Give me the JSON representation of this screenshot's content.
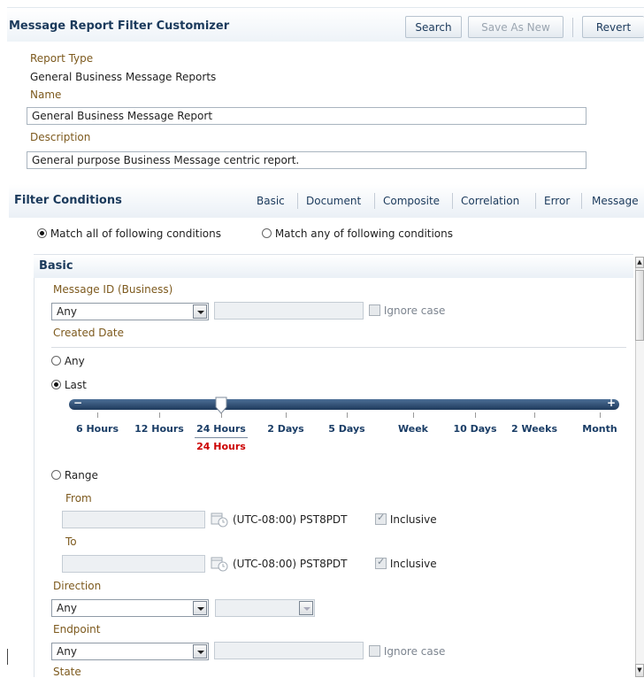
{
  "header": {
    "title": "Message Report Filter Customizer",
    "search_label": "Search",
    "save_as_new_label": "Save As New",
    "revert_label": "Revert"
  },
  "report": {
    "type_label": "Report Type",
    "type_value": "General Business Message Reports",
    "name_label": "Name",
    "name_value": "General Business Message Report",
    "description_label": "Description",
    "description_value": "General purpose Business Message centric report."
  },
  "filter": {
    "title": "Filter Conditions",
    "tabs": [
      "Basic",
      "Document",
      "Composite",
      "Correlation",
      "Error",
      "Message"
    ],
    "match_all_label": "Match all of following conditions",
    "match_any_label": "Match any of following conditions",
    "match_selected": "all"
  },
  "basic": {
    "title": "Basic",
    "message_id_label": "Message ID (Business)",
    "message_id_select": "Any",
    "message_id_value": "",
    "ignore_case_label": "Ignore case",
    "created_date_label": "Created Date",
    "any_label": "Any",
    "last_label": "Last",
    "created_selected": "last",
    "slider": {
      "stops": [
        "6 Hours",
        "12 Hours",
        "24 Hours",
        "2 Days",
        "5 Days",
        "Week",
        "10 Days",
        "2 Weeks",
        "Month"
      ],
      "selected_index": 2,
      "selected_label": "24 Hours",
      "minus_glyph": "−",
      "plus_glyph": "+"
    },
    "range_label": "Range",
    "from_label": "From",
    "from_value": "",
    "from_tz": "(UTC-08:00) PST8PDT",
    "to_label": "To",
    "to_value": "",
    "to_tz": "(UTC-08:00) PST8PDT",
    "inclusive_label": "Inclusive",
    "direction_label": "Direction",
    "direction_select": "Any",
    "direction_second_select": "",
    "endpoint_label": "Endpoint",
    "endpoint_select": "Any",
    "endpoint_value": "",
    "endpoint_ignore_case_label": "Ignore case",
    "state_label": "State"
  },
  "colors": {
    "title_blue": "#1b3a5c",
    "label_brown": "#7d5a1e",
    "selected_red": "#cc0000",
    "slider_dark": "#1f3a5c"
  }
}
